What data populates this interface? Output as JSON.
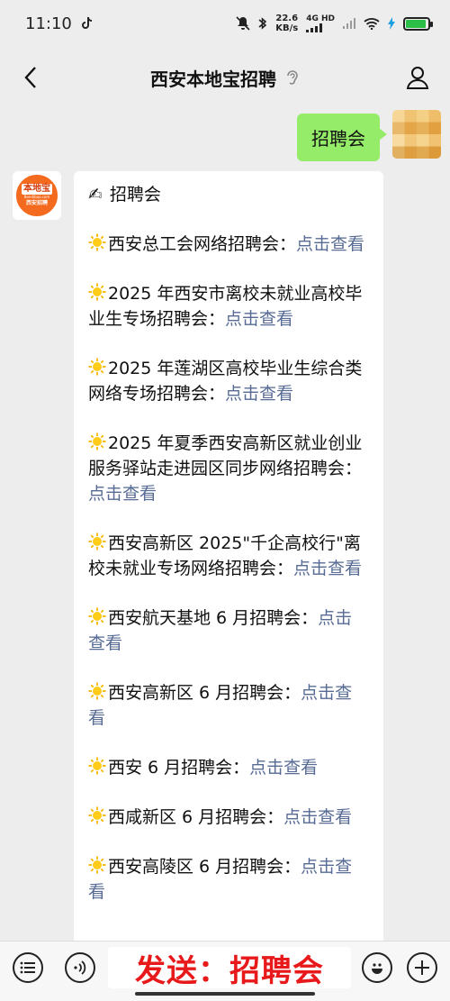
{
  "status": {
    "time": "11:10",
    "speed_value": "22.6",
    "speed_unit": "KB/s",
    "network": "4G HD",
    "battery_percent": 90
  },
  "nav": {
    "title": "西安本地宝招聘"
  },
  "sent_message": "招聘会",
  "bot": {
    "logo_main": "本地宝",
    "logo_domain": "Bendibao.com",
    "logo_sub": "西安招聘"
  },
  "reply": {
    "heading_emoji": "✍",
    "heading": "招聘会",
    "items": [
      {
        "text": "西安总工会网络招聘会：",
        "link": "点击查看"
      },
      {
        "text": "2025 年西安市离校未就业高校毕业生专场招聘会：",
        "link": "点击查看"
      },
      {
        "text": "2025 年莲湖区高校毕业生综合类网络专场招聘会：",
        "link": "点击查看"
      },
      {
        "text": "2025 年夏季西安高新区就业创业服务驿站走进园区同步网络招聘会：",
        "link": "点击查看"
      },
      {
        "text": "西安高新区 2025\"千企高校行\"离校未就业专场网络招聘会：",
        "link": "点击查看"
      },
      {
        "text": "西安航天基地 6 月招聘会：",
        "link": "点击查看"
      },
      {
        "text": "西安高新区 6 月招聘会：",
        "link": "点击查看"
      },
      {
        "text": "西安 6 月招聘会：",
        "link": "点击查看"
      },
      {
        "text": "西咸新区 6 月招聘会：",
        "link": "点击查看"
      },
      {
        "text": "西安高陵区 6 月招聘会：",
        "link": "点击查看"
      }
    ]
  },
  "input": {
    "overlay_text": "发送：招聘会"
  },
  "colors": {
    "bubble_sent": "#95ec69",
    "link": "#576b95",
    "overlay_text": "#e8191a"
  }
}
